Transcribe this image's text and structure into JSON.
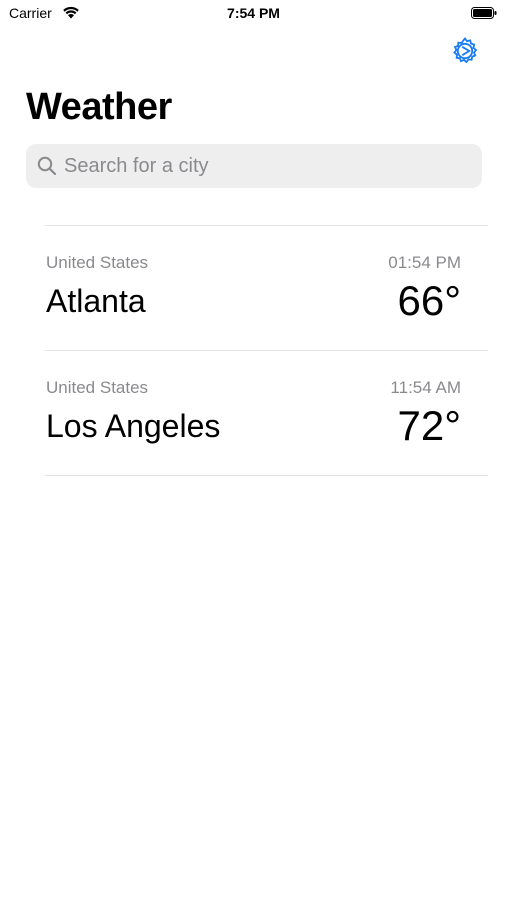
{
  "status_bar": {
    "carrier": "Carrier",
    "time": "7:54 PM"
  },
  "header": {
    "title": "Weather",
    "settings_icon": "gear-icon",
    "accent_color": "#1a7cf5"
  },
  "search": {
    "placeholder": "Search for a city",
    "value": ""
  },
  "cities": [
    {
      "country": "United States",
      "time": "01:54 PM",
      "name": "Atlanta",
      "temperature": "66°"
    },
    {
      "country": "United States",
      "time": "11:54 AM",
      "name": "Los Angeles",
      "temperature": "72°"
    }
  ]
}
